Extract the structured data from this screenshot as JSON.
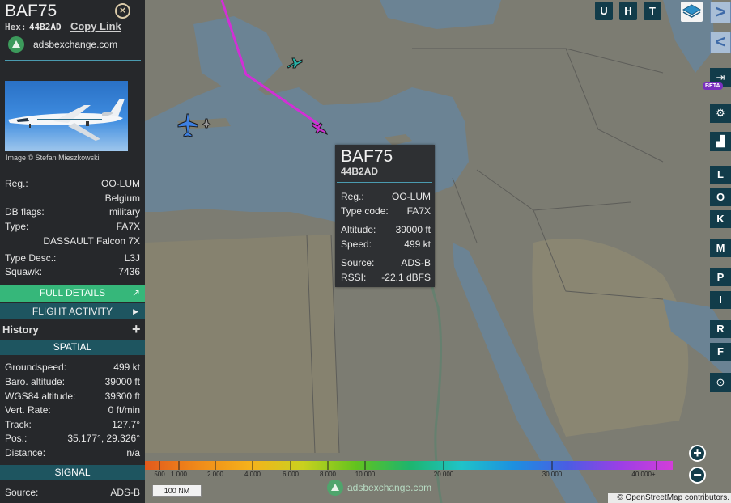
{
  "aircraft": {
    "callsign": "BAF75",
    "hex_label": "Hex:",
    "hex": "44B2AD",
    "copy_link": "Copy Link",
    "site": "adsbexchange.com",
    "photo_credit": "Image © Stefan Mieszkowski",
    "details": [
      {
        "label": "Reg.:",
        "value": "OO-LUM"
      },
      {
        "label": "",
        "value": "Belgium"
      },
      {
        "label": "DB flags:",
        "value": "military"
      },
      {
        "label": "Type:",
        "value": "FA7X"
      },
      {
        "label": "",
        "value": "DASSAULT Falcon 7X"
      },
      {
        "label": "Type Desc.:",
        "value": "L3J"
      },
      {
        "label": "Squawk:",
        "value": "7436"
      }
    ]
  },
  "buttons": {
    "full_details": "FULL DETAILS",
    "full_details_icon": "external-link-icon",
    "flight_activity": "FLIGHT ACTIVITY",
    "history": "History",
    "history_toggle": "+"
  },
  "spatial": {
    "title": "SPATIAL",
    "rows": [
      {
        "label": "Groundspeed:",
        "value": "499 kt"
      },
      {
        "label": "Baro. altitude:",
        "value": "39000 ft"
      },
      {
        "label": "WGS84 altitude:",
        "value": "39300 ft"
      },
      {
        "label": "Vert. Rate:",
        "value": "0 ft/min"
      },
      {
        "label": "Track:",
        "value": "127.7°"
      },
      {
        "label": "Pos.:",
        "value": "35.177°, 29.326°"
      },
      {
        "label": "Distance:",
        "value": "n/a"
      }
    ]
  },
  "signal": {
    "title": "SIGNAL",
    "rows": [
      {
        "label": "Source:",
        "value": "ADS-B"
      }
    ]
  },
  "tooltip": {
    "callsign": "BAF75",
    "hex": "44B2AD",
    "rows": [
      {
        "label": "Reg.:",
        "value": "OO-LUM"
      },
      {
        "label": "Type code:",
        "value": "FA7X"
      },
      {
        "label": "Altitude:",
        "value": "39000 ft"
      },
      {
        "label": "Speed:",
        "value": "499 kt"
      },
      {
        "label": "Source:",
        "value": "ADS-B"
      },
      {
        "label": "RSSI:",
        "value": "-22.1 dBFS"
      }
    ]
  },
  "map_controls": {
    "top": [
      "U",
      "H",
      "T"
    ],
    "side_letters": [
      "L",
      "O",
      "K",
      "M",
      "P",
      "I",
      "R",
      "F"
    ],
    "beta": "BETA",
    "next": ">",
    "prev": "<",
    "zoom_in": "+",
    "zoom_out": "−"
  },
  "altitude_legend": {
    "labels": [
      "500",
      "1 000",
      "2 000",
      "4 000",
      "6 000",
      "8 000",
      "10 000",
      "20 000",
      "30 000",
      "40 000+"
    ],
    "colors": [
      "#e25a1c",
      "#f08a1a",
      "#f5b21b",
      "#c9d11f",
      "#62c31e",
      "#1eb56c",
      "#1fc3c8",
      "#1d8fe0",
      "#4a5de3",
      "#9b3fe6",
      "#d33dd9"
    ]
  },
  "scale": "100 NM",
  "brand": "adsbexchange.com",
  "attribution": {
    "prefix": "©",
    "link": "OpenStreetMap",
    "suffix": "contributors."
  }
}
